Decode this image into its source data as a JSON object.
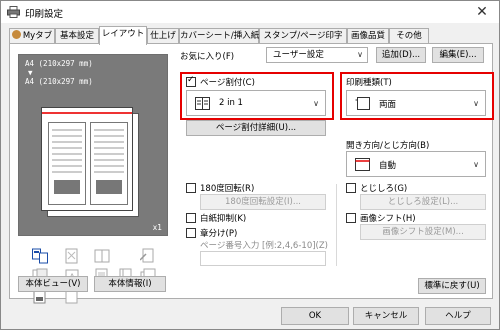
{
  "window": {
    "title": "印刷設定",
    "close_glyph": "✕"
  },
  "tabs": [
    {
      "label": "Myタブ"
    },
    {
      "label": "基本設定"
    },
    {
      "label": "レイアウト",
      "active": true
    },
    {
      "label": "仕上げ"
    },
    {
      "label": "カバーシート/挿入紙"
    },
    {
      "label": "スタンプ/ページ印字"
    },
    {
      "label": "画像品質"
    },
    {
      "label": "その他"
    }
  ],
  "preview": {
    "paper_line1": "A4 (210x297 mm)",
    "arrow": "▼",
    "paper_line2": "A4 (210x297 mm)",
    "copies": "x1"
  },
  "left_buttons": {
    "view": "本体ビュー(V)",
    "info": "本体情報(I)"
  },
  "favorites": {
    "label": "お気に入り(F)",
    "value": "ユーザー設定",
    "add": "追加(D)...",
    "edit": "編集(E)..."
  },
  "page_combine": {
    "checkbox_label": "ページ割付(C)",
    "checked": true,
    "value": "2 in 1",
    "details": "ページ割付詳細(U)..."
  },
  "print_type": {
    "label": "印刷種類(T)",
    "value": "両面"
  },
  "binding": {
    "label": "開き方向/とじ方向(B)",
    "value": "自動"
  },
  "rotate": {
    "label": "180度回転(R)",
    "details": "180度回転設定(I)..."
  },
  "binding_margin": {
    "label": "とじしろ(G)",
    "details": "とじしろ設定(L)..."
  },
  "blank_suppress": {
    "label": "白紙抑制(K)"
  },
  "image_shift": {
    "label": "画像シフト(H)",
    "details": "画像シフト設定(M)..."
  },
  "chapter": {
    "label": "章分け(P)",
    "page_input_label": "ページ番号入力 [例:2,4,6-10](Z)"
  },
  "reset_button": "標準に戻す(U)",
  "footer": {
    "ok": "OK",
    "cancel": "キャンセル",
    "help": "ヘルプ"
  },
  "colors": {
    "highlight": "#e60000",
    "preview_bg": "#7a7a7a"
  }
}
